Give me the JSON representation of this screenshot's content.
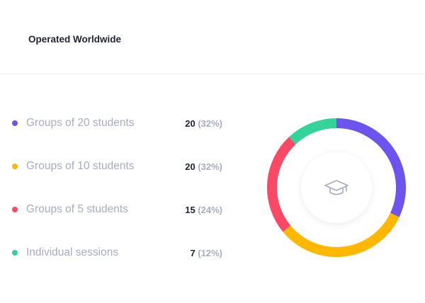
{
  "header": {
    "title": "Operated Worldwide"
  },
  "legend": [
    {
      "label": "Groups of 20 students",
      "count": "20",
      "percent": "(32%)",
      "color": "#6d54ee"
    },
    {
      "label": "Groups of 10 students",
      "count": "20",
      "percent": "(32%)",
      "color": "#ffb700"
    },
    {
      "label": "Groups of 5 students",
      "count": "15",
      "percent": "(24%)",
      "color": "#f94965"
    },
    {
      "label": "Individual sessions",
      "count": "7",
      "percent": "(12%)",
      "color": "#34d39a"
    }
  ],
  "center_icon": "graduation-cap-icon",
  "chart_data": {
    "type": "pie",
    "categories": [
      "Groups of 20 students",
      "Groups of 10 students",
      "Groups of 5 students",
      "Individual sessions"
    ],
    "values": [
      32,
      32,
      24,
      12
    ],
    "colors": [
      "#6d54ee",
      "#ffb700",
      "#f94965",
      "#34d39a"
    ]
  }
}
